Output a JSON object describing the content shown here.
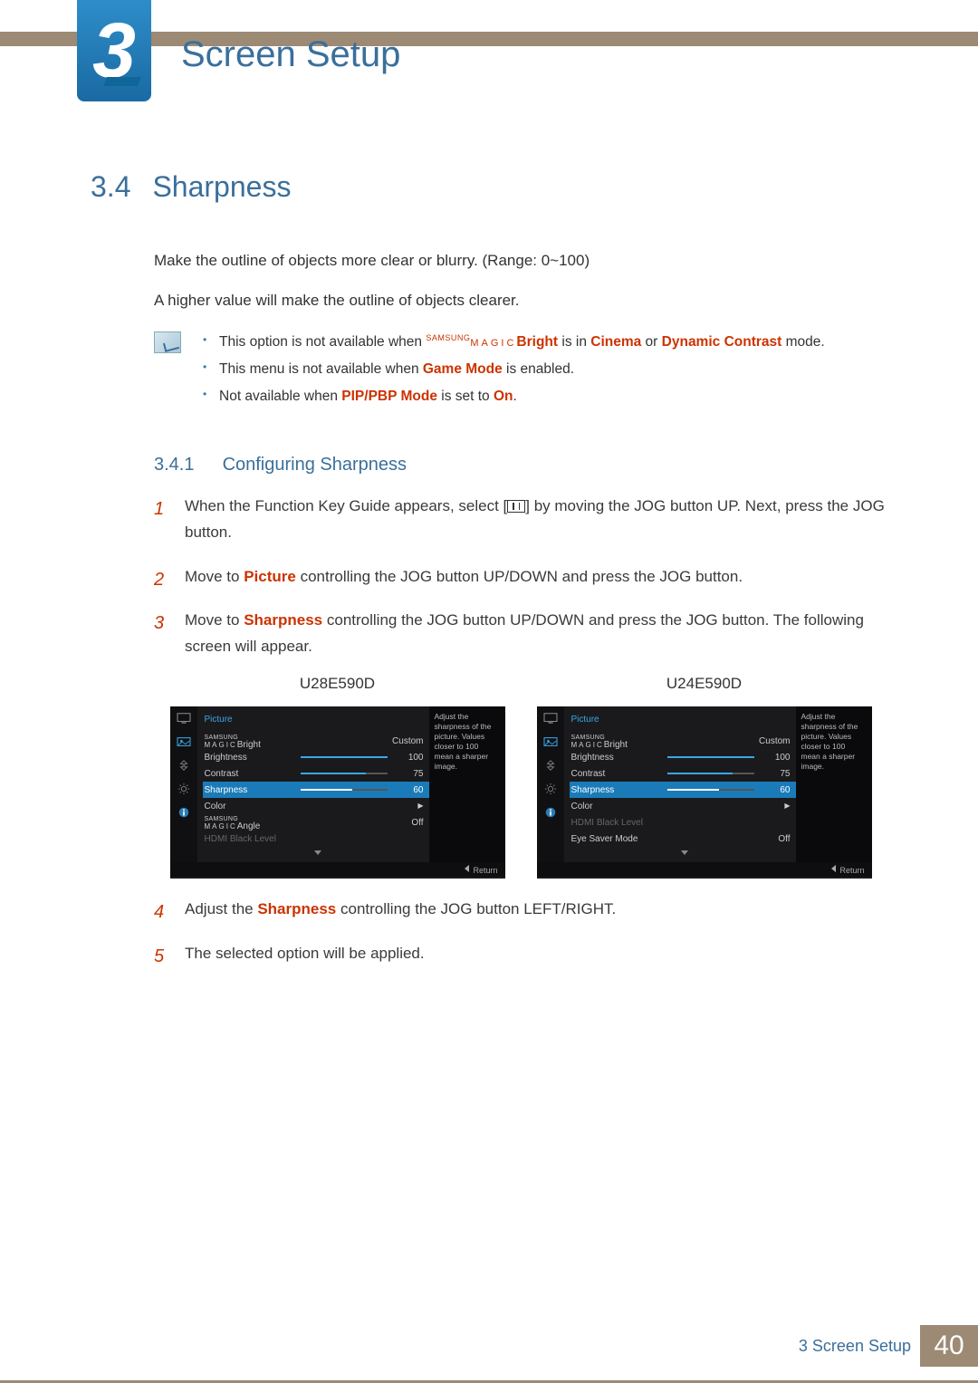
{
  "chapter": {
    "number": "3",
    "title": "Screen Setup"
  },
  "section": {
    "number": "3.4",
    "title": "Sharpness"
  },
  "intro": {
    "p1": "Make the outline of objects more clear or blurry. (Range: 0~100)",
    "p2": "A higher value will make the outline of objects clearer."
  },
  "notes": {
    "n1_a": "This option is not available when ",
    "n1_brand_pre": "SAMSUNG",
    "n1_brand_mag": "MAGIC",
    "n1_brand_suf": "Bright",
    "n1_b": " is in ",
    "n1_c": "Cinema",
    "n1_d": " or ",
    "n1_e": "Dynamic Contrast",
    "n1_f": " mode.",
    "n2_a": "This menu is not available when ",
    "n2_b": "Game Mode",
    "n2_c": " is enabled.",
    "n3_a": "Not available when ",
    "n3_b": "PIP/PBP Mode",
    "n3_c": " is set to ",
    "n3_d": "On",
    "n3_e": "."
  },
  "subsection": {
    "number": "3.4.1",
    "title": "Configuring Sharpness"
  },
  "steps": {
    "s1a": "When the Function Key Guide appears, select [",
    "s1b": "] by moving the JOG button UP. Next, press the JOG button.",
    "s2a": "Move to ",
    "s2b": "Picture",
    "s2c": " controlling the JOG button UP/DOWN and press the JOG button.",
    "s3a": "Move to ",
    "s3b": "Sharpness",
    "s3c": " controlling the JOG button UP/DOWN and press the JOG button. The following screen will appear.",
    "s4a": "Adjust the ",
    "s4b": "Sharpness",
    "s4c": " controlling the JOG button LEFT/RIGHT.",
    "s5": "The selected option will be applied."
  },
  "models": {
    "left": "U28E590D",
    "right": "U24E590D"
  },
  "osd": {
    "header": "Picture",
    "tip": "Adjust the sharpness of the picture. Values closer to 100 mean a sharper image.",
    "return": "Return",
    "magic_pre": "SAMSUNG",
    "magic_mag": "MAGIC",
    "left": {
      "rows": [
        {
          "label_suffix": "Bright",
          "magic": true,
          "value": "Custom",
          "type": "text"
        },
        {
          "label": "Brightness",
          "value": "100",
          "bar": 100,
          "type": "bar"
        },
        {
          "label": "Contrast",
          "value": "75",
          "bar": 75,
          "type": "bar"
        },
        {
          "label": "Sharpness",
          "value": "60",
          "bar": 60,
          "type": "bar",
          "selected": true
        },
        {
          "label": "Color",
          "type": "arrow"
        },
        {
          "label_suffix": "Angle",
          "magic": true,
          "value": "Off",
          "type": "text"
        },
        {
          "label": "HDMI Black Level",
          "type": "dim"
        }
      ]
    },
    "right": {
      "rows": [
        {
          "label_suffix": "Bright",
          "magic": true,
          "value": "Custom",
          "type": "text"
        },
        {
          "label": "Brightness",
          "value": "100",
          "bar": 100,
          "type": "bar"
        },
        {
          "label": "Contrast",
          "value": "75",
          "bar": 75,
          "type": "bar"
        },
        {
          "label": "Sharpness",
          "value": "60",
          "bar": 60,
          "type": "bar",
          "selected": true
        },
        {
          "label": "Color",
          "type": "arrow"
        },
        {
          "label": "HDMI Black Level",
          "type": "dim"
        },
        {
          "label": "Eye Saver Mode",
          "value": "Off",
          "type": "text"
        }
      ]
    }
  },
  "footer": {
    "text": "3 Screen Setup",
    "page": "40"
  }
}
